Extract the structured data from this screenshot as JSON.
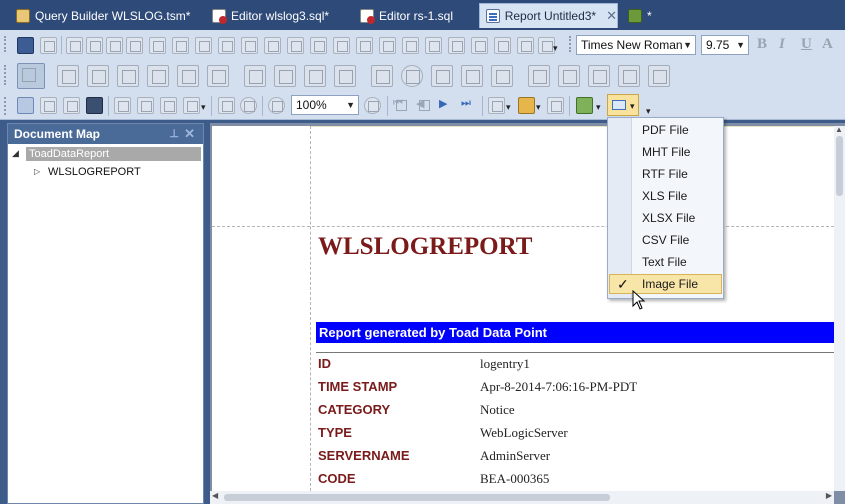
{
  "tabs": [
    {
      "label": "Query Builder WLSLOG.tsm*",
      "icon": "query-builder-icon"
    },
    {
      "label": "Editor wlslog3.sql*",
      "icon": "sql-editor-icon"
    },
    {
      "label": "Editor rs-1.sql",
      "icon": "sql-editor-icon"
    },
    {
      "label": "Report Untitled3*",
      "icon": "report-icon",
      "active": true,
      "close": "✕"
    },
    {
      "label": "*",
      "icon": "new-tab-icon"
    }
  ],
  "toolbar": {
    "font_name": "Times New Roman",
    "font_size": "9.75",
    "zoom": "100%",
    "bold": "B",
    "italic": "I",
    "underline": "U",
    "font_color": "A"
  },
  "document_map": {
    "title": "Document Map",
    "root": "ToadDataReport",
    "child": "WLSLOGREPORT"
  },
  "report": {
    "title": "WLSLOGREPORT",
    "banner": "Report generated by Toad Data Point",
    "fields": [
      {
        "key": "ID",
        "value": "logentry1"
      },
      {
        "key": "TIME STAMP",
        "value": "Apr-8-2014-7:06:16-PM-PDT"
      },
      {
        "key": "CATEGORY",
        "value": "Notice"
      },
      {
        "key": "TYPE",
        "value": "WebLogicServer"
      },
      {
        "key": "SERVERNAME",
        "value": "AdminServer"
      },
      {
        "key": "CODE",
        "value": "BEA-000365"
      }
    ]
  },
  "export_menu": {
    "items": [
      {
        "label": "PDF File"
      },
      {
        "label": "MHT File"
      },
      {
        "label": "RTF File"
      },
      {
        "label": "XLS File"
      },
      {
        "label": "XLSX File"
      },
      {
        "label": "CSV File"
      },
      {
        "label": "Text File"
      },
      {
        "label": "Image File",
        "checked": true
      }
    ],
    "check_mark": "✓"
  }
}
